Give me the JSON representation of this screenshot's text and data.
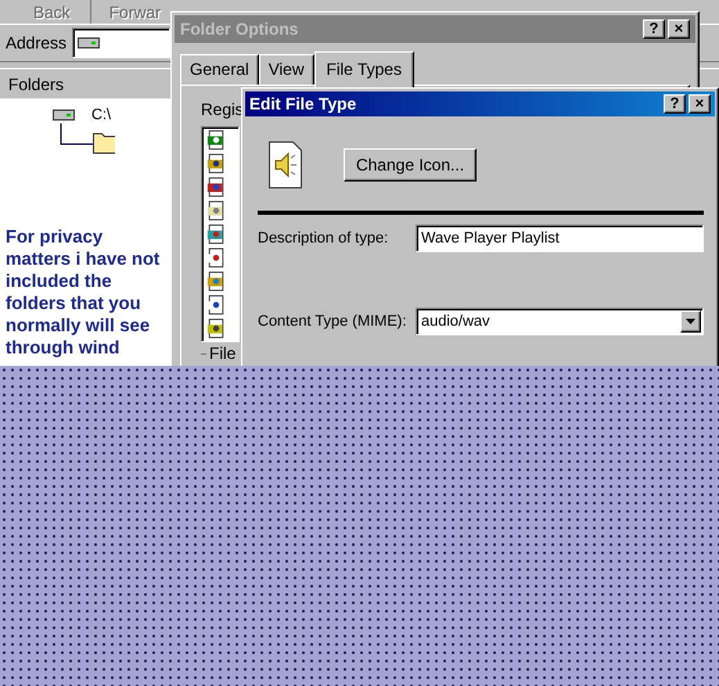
{
  "explorer": {
    "toolbar": [
      {
        "label": "Back",
        "disabled": true
      },
      {
        "label": "Forwar",
        "disabled": true
      }
    ],
    "address": {
      "label": "Address"
    },
    "folders_header": "Folders",
    "tree": [
      {
        "label": "C:\\"
      }
    ],
    "privacy_note": "For privacy matters i have not included the folders that you normally will see through wind"
  },
  "folder_options": {
    "title": "Folder Options",
    "active": false,
    "tabs": [
      {
        "label": "General",
        "selected": false
      },
      {
        "label": "View",
        "selected": false
      },
      {
        "label": "File Types",
        "selected": true
      }
    ],
    "title_buttons": [
      "?",
      "×"
    ],
    "list_label": "Regis",
    "group_label": "File"
  },
  "edit_file_type": {
    "title": "Edit File Type",
    "active": true,
    "title_buttons": [
      "?",
      "×"
    ],
    "change_icon_button": "Change Icon...",
    "fields": [
      {
        "kind": "text",
        "label": "Description of type:",
        "value": "Wave Player Playlist"
      },
      {
        "kind": "combo",
        "label": "Content Type (MIME):",
        "value": "audio/wav"
      }
    ]
  }
}
